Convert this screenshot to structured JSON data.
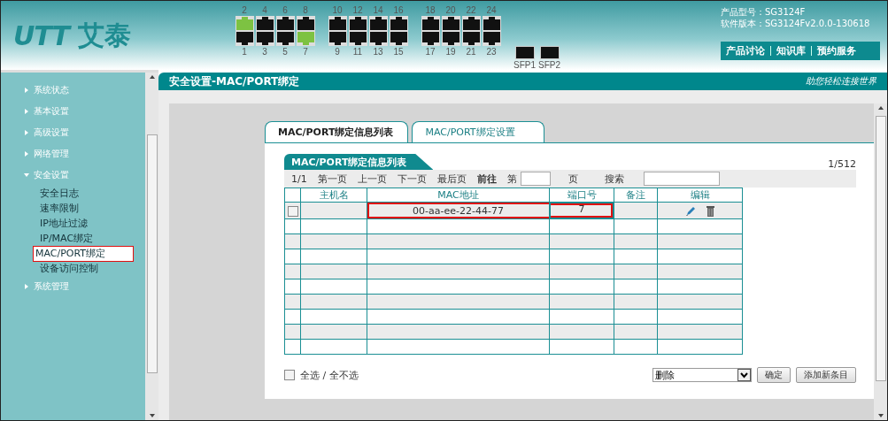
{
  "header": {
    "logo": {
      "mark": "UTT",
      "name": "艾泰"
    },
    "top_ports": [
      {
        "label": "2",
        "link": true
      },
      {
        "label": "4",
        "link": false
      },
      {
        "label": "6",
        "link": false
      },
      {
        "label": "8",
        "link": false
      },
      {
        "label": "10",
        "link": false
      },
      {
        "label": "12",
        "link": false
      },
      {
        "label": "14",
        "link": false
      },
      {
        "label": "16",
        "link": false
      },
      {
        "label": "18",
        "link": false
      },
      {
        "label": "20",
        "link": false
      },
      {
        "label": "22",
        "link": false
      },
      {
        "label": "24",
        "link": false
      }
    ],
    "bottom_ports": [
      {
        "label": "1",
        "link": false
      },
      {
        "label": "3",
        "link": false
      },
      {
        "label": "5",
        "link": false
      },
      {
        "label": "7",
        "link": true
      },
      {
        "label": "9",
        "link": false
      },
      {
        "label": "11",
        "link": false
      },
      {
        "label": "13",
        "link": false
      },
      {
        "label": "15",
        "link": false
      },
      {
        "label": "17",
        "link": false
      },
      {
        "label": "19",
        "link": false
      },
      {
        "label": "21",
        "link": false
      },
      {
        "label": "23",
        "link": false
      }
    ],
    "sfp_ports": [
      {
        "label": "SFP1"
      },
      {
        "label": "SFP2"
      }
    ],
    "product_model": "产品型号：SG3124F",
    "software_version": "软件版本：SG3124Fv2.0.0-130618",
    "links": [
      "产品讨论",
      "知识库",
      "预约服务"
    ]
  },
  "sidebar": {
    "items": [
      {
        "label": "系统状态",
        "expanded": false
      },
      {
        "label": "基本设置",
        "expanded": false
      },
      {
        "label": "高级设置",
        "expanded": false
      },
      {
        "label": "网络管理",
        "expanded": false
      },
      {
        "label": "安全设置",
        "expanded": true,
        "children": [
          {
            "label": "安全日志",
            "selected": false
          },
          {
            "label": "速率限制",
            "selected": false
          },
          {
            "label": "IP地址过滤",
            "selected": false
          },
          {
            "label": "IP/MAC绑定",
            "selected": false
          },
          {
            "label": "MAC/PORT绑定",
            "selected": true
          },
          {
            "label": "设备访问控制",
            "selected": false
          }
        ]
      },
      {
        "label": "系统管理",
        "expanded": false
      }
    ]
  },
  "page": {
    "title": "安全设置-MAC/PORT绑定",
    "slogan": "助您轻松连接世界",
    "tabs": [
      {
        "label": "MAC/PORT绑定信息列表",
        "selected": true
      },
      {
        "label": "MAC/PORT绑定设置",
        "selected": false
      }
    ],
    "list_title": "MAC/PORT绑定信息列表",
    "count": "1/512",
    "pager": {
      "page": "1/1",
      "first": "第一页",
      "prev": "上一页",
      "next": "下一页",
      "last": "最后页",
      "goto": "前往",
      "page_prefix": "第",
      "page_suffix": "页",
      "search": "搜索"
    },
    "table": {
      "columns": [
        "主机名",
        "MAC地址",
        "端口号",
        "备注",
        "编辑"
      ],
      "rows": [
        {
          "checked": false,
          "mac": "00-aa-ee-22-44-77",
          "port": "7",
          "highlighted": true
        }
      ]
    },
    "select_all": {
      "label": "全选 / 全不选",
      "checked": false
    },
    "action_select": {
      "value": "删除"
    },
    "buttons": [
      "确定",
      "添加新条目"
    ]
  }
}
